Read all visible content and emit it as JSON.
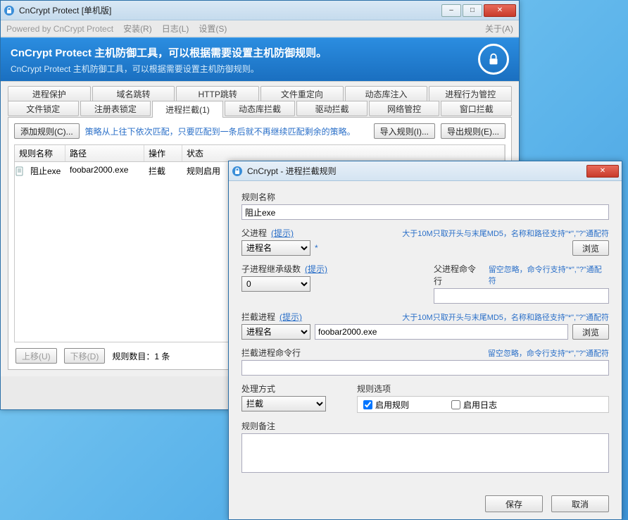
{
  "main": {
    "title": "CnCrypt Protect [单机版]",
    "menubar": {
      "powered": "Powered by CnCrypt Protect",
      "install": "安装(R)",
      "log": "日志(L)",
      "settings": "设置(S)",
      "about": "关于(A)"
    },
    "banner": {
      "title": "CnCrypt Protect 主机防御工具，可以根据需要设置主机防御规则。",
      "sub": "CnCrypt Protect 主机防御工具，可以根据需要设置主机防御规则。"
    },
    "tabs_row1": [
      "进程保护",
      "域名跳转",
      "HTTP跳转",
      "文件重定向",
      "动态库注入",
      "进程行为管控"
    ],
    "tabs_row2": [
      "文件锁定",
      "注册表锁定",
      "进程拦截(1)",
      "动态库拦截",
      "驱动拦截",
      "网络管控",
      "窗口拦截"
    ],
    "tabs_row2_active_index": 2,
    "toolbar": {
      "add": "添加规则(C)...",
      "hint": "策略从上往下依次匹配，只要匹配到一条后就不再继续匹配剩余的策略。",
      "import": "导入规则(I)...",
      "export": "导出规则(E)..."
    },
    "list": {
      "headers": {
        "name": "规则名称",
        "path": "路径",
        "op": "操作",
        "status": "状态"
      },
      "rows": [
        {
          "name": "阻止exe",
          "path": "foobar2000.exe",
          "op": "拦截",
          "status": "规则启用"
        }
      ]
    },
    "bottom": {
      "up": "上移(U)",
      "down": "下移(D)",
      "count_label": "规则数目：1 条"
    }
  },
  "dialog": {
    "title": "CnCrypt - 进程拦截规则",
    "rule_name_label": "规则名称",
    "rule_name_value": "阻止exe",
    "parent_label": "父进程",
    "tip": "(提示)",
    "parent_hint": "大于10M只取开头与末尾MD5，名称和路径支持\"*\",\"?\"通配符",
    "proc_name_option": "进程名",
    "star": "*",
    "browse": "浏览",
    "inherit_label": "子进程继承级数",
    "inherit_value": "0",
    "parent_cmd_label": "父进程命令行",
    "cmd_hint": "留空忽略，命令行支持\"*\",\"?\"通配符",
    "block_label": "拦截进程",
    "block_hint": "大于10M只取开头与末尾MD5，名称和路径支持\"*\",\"?\"通配符",
    "block_value": "foobar2000.exe",
    "block_cmd_label": "拦截进程命令行",
    "handle_label": "处理方式",
    "handle_value": "拦截",
    "options_label": "规则选项",
    "enable_rule": "启用规则",
    "enable_log": "启用日志",
    "remarks_label": "规则备注",
    "save": "保存",
    "cancel": "取消"
  }
}
